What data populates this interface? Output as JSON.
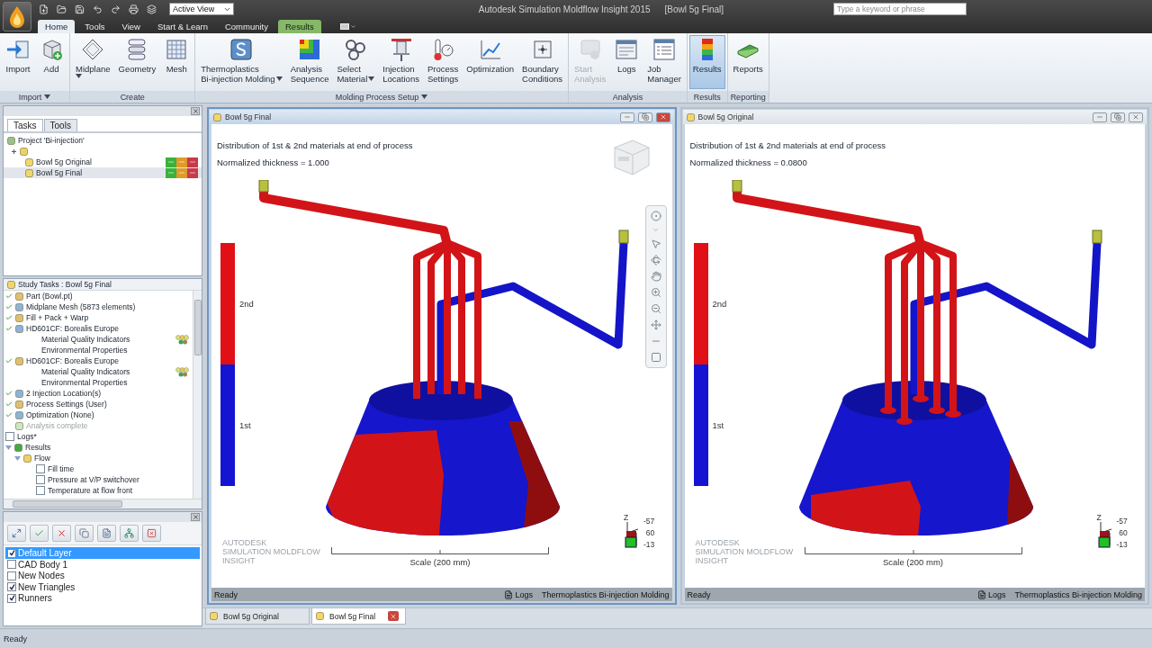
{
  "app": {
    "title": "Autodesk Simulation Moldflow Insight 2015",
    "document": "[Bowl 5g Final]",
    "view_selector": "Active View",
    "search": {
      "placeholder": "Type a keyword or phrase"
    }
  },
  "ribbon_tabs": [
    {
      "label": "Home",
      "selected": true,
      "contextual": false
    },
    {
      "label": "Tools",
      "selected": false,
      "contextual": false
    },
    {
      "label": "View",
      "selected": false,
      "contextual": false
    },
    {
      "label": "Start & Learn",
      "selected": false,
      "contextual": false
    },
    {
      "label": "Community",
      "selected": false,
      "contextual": false
    },
    {
      "label": "Results",
      "selected": false,
      "contextual": true
    }
  ],
  "ribbon_groups": [
    {
      "label": "Import",
      "menu": true,
      "buttons": [
        {
          "label": [
            "Import"
          ],
          "menu": false,
          "disabled": false,
          "selected": false
        },
        {
          "label": [
            "Add"
          ],
          "menu": false,
          "disabled": false,
          "selected": false
        }
      ]
    },
    {
      "label": "Create",
      "menu": false,
      "buttons": [
        {
          "label": [
            "Midplane"
          ],
          "menu": true,
          "disabled": false,
          "selected": false
        },
        {
          "label": [
            "Geometry"
          ],
          "menu": false,
          "disabled": false,
          "selected": false
        },
        {
          "label": [
            "Mesh"
          ],
          "menu": false,
          "disabled": false,
          "selected": false
        }
      ]
    },
    {
      "label": "Molding Process Setup",
      "menu": true,
      "buttons": [
        {
          "label": [
            "Thermoplastics",
            "Bi-injection Molding"
          ],
          "menu": true,
          "disabled": false,
          "selected": false
        },
        {
          "label": [
            "Analysis",
            "Sequence"
          ],
          "menu": false,
          "disabled": false,
          "selected": false
        },
        {
          "label": [
            "Select",
            "Material"
          ],
          "menu": true,
          "disabled": false,
          "selected": false
        },
        {
          "label": [
            "Injection",
            "Locations"
          ],
          "menu": false,
          "disabled": false,
          "selected": false
        },
        {
          "label": [
            "Process",
            "Settings"
          ],
          "menu": false,
          "disabled": false,
          "selected": false
        },
        {
          "label": [
            "Optimization"
          ],
          "menu": false,
          "disabled": false,
          "selected": false
        },
        {
          "label": [
            "Boundary",
            "Conditions"
          ],
          "menu": false,
          "disabled": false,
          "selected": false
        }
      ]
    },
    {
      "label": "Analysis",
      "menu": false,
      "buttons": [
        {
          "label": [
            "Start",
            "Analysis"
          ],
          "menu": false,
          "disabled": true,
          "selected": false
        },
        {
          "label": [
            "Logs"
          ],
          "menu": false,
          "disabled": false,
          "selected": false
        },
        {
          "label": [
            "Job",
            "Manager"
          ],
          "menu": false,
          "disabled": false,
          "selected": false
        }
      ]
    },
    {
      "label": "Results",
      "menu": false,
      "buttons": [
        {
          "label": [
            "Results"
          ],
          "menu": false,
          "disabled": false,
          "selected": true
        }
      ]
    },
    {
      "label": "Reporting",
      "menu": false,
      "buttons": [
        {
          "label": [
            "Reports"
          ],
          "menu": false,
          "disabled": false,
          "selected": false
        }
      ]
    }
  ],
  "tasks_panel": {
    "tabs": [
      {
        "label": "Tasks",
        "selected": true
      },
      {
        "label": "Tools",
        "selected": false
      }
    ],
    "tree": [
      {
        "kind": "project",
        "label": "Project 'Bi-injection'",
        "children": [
          {
            "kind": "folder",
            "expanded": false
          },
          {
            "kind": "study",
            "label": "Bowl 5g Original",
            "selected": false
          },
          {
            "kind": "study",
            "label": "Bowl 5g Final",
            "selected": true
          }
        ]
      }
    ]
  },
  "study_tasks": {
    "title": "Study Tasks : Bowl 5g Final",
    "items": [
      {
        "kind": "task",
        "label": "Part (Bowl.pt)",
        "done": true
      },
      {
        "kind": "task",
        "label": "Midplane Mesh (5873 elements)",
        "done": true
      },
      {
        "kind": "task",
        "label": "Fill + Pack + Warp",
        "done": true
      },
      {
        "kind": "task",
        "label": "HD601CF: Borealis Europe",
        "done": true,
        "children": [
          {
            "kind": "property",
            "label": "Material Quality Indicators"
          },
          {
            "kind": "property",
            "label": "Environmental Properties"
          }
        ]
      },
      {
        "kind": "task",
        "label": "HD601CF: Borealis Europe",
        "done": true,
        "children": [
          {
            "kind": "property",
            "label": "Material Quality Indicators"
          },
          {
            "kind": "property",
            "label": "Environmental Properties"
          }
        ]
      },
      {
        "kind": "task",
        "label": "2 Injection Location(s)",
        "done": true
      },
      {
        "kind": "task",
        "label": "Process Settings (User)",
        "done": true
      },
      {
        "kind": "task",
        "label": "Optimization (None)",
        "done": true
      },
      {
        "kind": "note",
        "label": "Analysis complete",
        "disabled": true
      },
      {
        "kind": "checkbox",
        "label": "Logs*",
        "checked": false
      },
      {
        "kind": "group",
        "label": "Results",
        "expanded": true,
        "children": [
          {
            "kind": "group",
            "label": "Flow",
            "expanded": true,
            "children": [
              {
                "kind": "checkbox",
                "label": "Fill time",
                "checked": false
              },
              {
                "kind": "checkbox",
                "label": "Pressure at V/P switchover",
                "checked": false
              },
              {
                "kind": "checkbox",
                "label": "Temperature at flow front",
                "checked": false
              }
            ]
          }
        ]
      }
    ]
  },
  "layers": {
    "items": [
      {
        "label": "Default Layer",
        "checked": true,
        "selected": true
      },
      {
        "label": "CAD Body 1",
        "checked": false,
        "selected": false
      },
      {
        "label": "New Nodes",
        "checked": false,
        "selected": false
      },
      {
        "label": "New Triangles",
        "checked": true,
        "selected": false
      },
      {
        "label": "Runners",
        "checked": true,
        "selected": false
      }
    ]
  },
  "viewports": [
    {
      "title": "Bowl 5g Final",
      "active": true,
      "info": [
        "Distribution of 1st & 2nd materials at end of process",
        "Normalized thickness = 1.000"
      ],
      "legend": [
        {
          "label": "2nd",
          "color": "#e01016"
        },
        {
          "label": "1st",
          "color": "#1414d2"
        }
      ],
      "scale": "Scale (200 mm)",
      "triad": {
        "axis": "Z",
        "values": [
          "-57",
          "60",
          "-13"
        ]
      },
      "watermark": [
        "AUTODESK",
        "SIMULATION MOLDFLOW",
        "INSIGHT"
      ],
      "status": "Ready",
      "logs": "Logs",
      "mode": "Thermoplastics Bi-injection Molding",
      "navigation_bar": true,
      "view_cube": true
    },
    {
      "title": "Bowl 5g Original",
      "active": false,
      "info": [
        "Distribution of 1st & 2nd materials at end of process",
        "Normalized thickness = 0.0800"
      ],
      "legend": [
        {
          "label": "2nd",
          "color": "#e01016"
        },
        {
          "label": "1st",
          "color": "#1414d2"
        }
      ],
      "scale": "Scale (200 mm)",
      "triad": {
        "axis": "Z",
        "values": [
          "-57",
          "60",
          "-13"
        ]
      },
      "watermark": [
        "AUTODESK",
        "SIMULATION MOLDFLOW",
        "INSIGHT"
      ],
      "status": "Ready",
      "logs": "Logs",
      "mode": "Thermoplastics Bi-injection Molding",
      "navigation_bar": false,
      "view_cube": false
    }
  ],
  "document_tabs": [
    {
      "label": "Bowl 5g Original",
      "selected": false
    },
    {
      "label": "Bowl 5g Final",
      "selected": true
    }
  ],
  "status_bar": "Ready"
}
